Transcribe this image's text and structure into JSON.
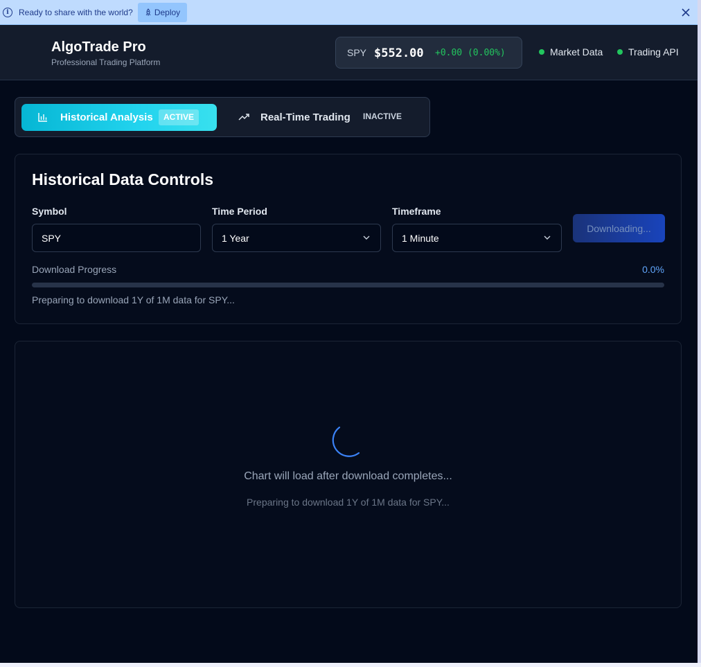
{
  "banner": {
    "info_icon": "info-icon",
    "text": "Ready to share with the world?",
    "deploy_label": "Deploy",
    "deploy_icon": "rocket-icon",
    "close_icon": "close-icon",
    "background": "#bfdbfe"
  },
  "header": {
    "title": "AlgoTrade Pro",
    "subtitle": "Professional Trading Platform",
    "ticker": {
      "symbol": "SPY",
      "price": "$552.00",
      "change": "+0.00 (0.00%)",
      "change_color": "#22c55e"
    },
    "statuses": [
      {
        "label": "Market Data",
        "color": "#22c55e"
      },
      {
        "label": "Trading API",
        "color": "#22c55e"
      }
    ]
  },
  "modes": {
    "tabs": [
      {
        "label": "Historical Analysis",
        "badge": "ACTIVE",
        "icon": "bar-chart-icon",
        "active": true
      },
      {
        "label": "Real-Time Trading",
        "badge": "INACTIVE",
        "icon": "trending-up-icon",
        "active": false
      }
    ],
    "accent": "#22d3ee"
  },
  "controls": {
    "title": "Historical Data Controls",
    "symbol": {
      "label": "Symbol",
      "value": "SPY"
    },
    "period": {
      "label": "Time Period",
      "value": "1 Year"
    },
    "timeframe": {
      "label": "Timeframe",
      "value": "1 Minute"
    },
    "download_button": "Downloading...",
    "progress": {
      "label": "Download Progress",
      "value_text": "0.0%",
      "fraction": 0.0,
      "message": "Preparing to download 1Y of 1M data for SPY..."
    }
  },
  "chart_area": {
    "message": "Chart will load after download completes...",
    "submessage": "Preparing to download 1Y of 1M data for SPY...",
    "spinner_icon": "loading-spinner-icon"
  }
}
